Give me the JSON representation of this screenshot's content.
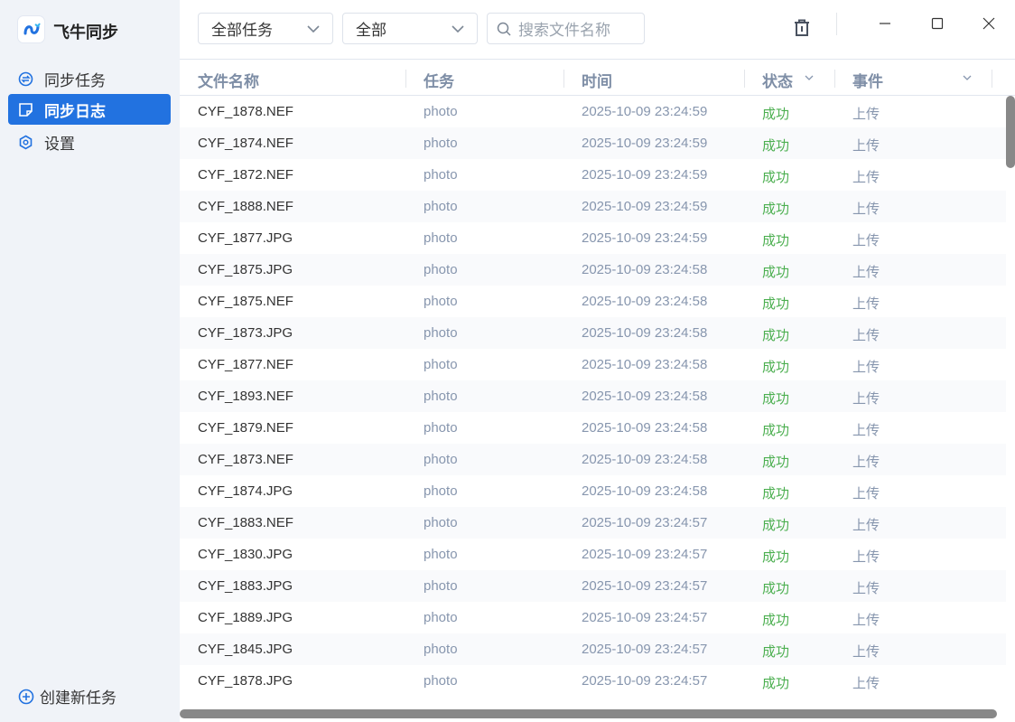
{
  "app": {
    "title": "飞牛同步"
  },
  "sidebar": {
    "items": [
      {
        "label": "同步任务"
      },
      {
        "label": "同步日志"
      },
      {
        "label": "设置"
      }
    ],
    "create_label": "创建新任务"
  },
  "toolbar": {
    "task_filter": "全部任务",
    "status_filter": "全部",
    "search_placeholder": "搜索文件名称"
  },
  "table": {
    "headers": [
      "文件名称",
      "任务",
      "时间",
      "状态",
      "事件"
    ],
    "rows": [
      [
        "CYF_1878.NEF",
        "photo",
        "2025-10-09 23:24:59",
        "成功",
        "上传"
      ],
      [
        "CYF_1874.NEF",
        "photo",
        "2025-10-09 23:24:59",
        "成功",
        "上传"
      ],
      [
        "CYF_1872.NEF",
        "photo",
        "2025-10-09 23:24:59",
        "成功",
        "上传"
      ],
      [
        "CYF_1888.NEF",
        "photo",
        "2025-10-09 23:24:59",
        "成功",
        "上传"
      ],
      [
        "CYF_1877.JPG",
        "photo",
        "2025-10-09 23:24:59",
        "成功",
        "上传"
      ],
      [
        "CYF_1875.JPG",
        "photo",
        "2025-10-09 23:24:58",
        "成功",
        "上传"
      ],
      [
        "CYF_1875.NEF",
        "photo",
        "2025-10-09 23:24:58",
        "成功",
        "上传"
      ],
      [
        "CYF_1873.JPG",
        "photo",
        "2025-10-09 23:24:58",
        "成功",
        "上传"
      ],
      [
        "CYF_1877.NEF",
        "photo",
        "2025-10-09 23:24:58",
        "成功",
        "上传"
      ],
      [
        "CYF_1893.NEF",
        "photo",
        "2025-10-09 23:24:58",
        "成功",
        "上传"
      ],
      [
        "CYF_1879.NEF",
        "photo",
        "2025-10-09 23:24:58",
        "成功",
        "上传"
      ],
      [
        "CYF_1873.NEF",
        "photo",
        "2025-10-09 23:24:58",
        "成功",
        "上传"
      ],
      [
        "CYF_1874.JPG",
        "photo",
        "2025-10-09 23:24:58",
        "成功",
        "上传"
      ],
      [
        "CYF_1883.NEF",
        "photo",
        "2025-10-09 23:24:57",
        "成功",
        "上传"
      ],
      [
        "CYF_1830.JPG",
        "photo",
        "2025-10-09 23:24:57",
        "成功",
        "上传"
      ],
      [
        "CYF_1883.JPG",
        "photo",
        "2025-10-09 23:24:57",
        "成功",
        "上传"
      ],
      [
        "CYF_1889.JPG",
        "photo",
        "2025-10-09 23:24:57",
        "成功",
        "上传"
      ],
      [
        "CYF_1845.JPG",
        "photo",
        "2025-10-09 23:24:57",
        "成功",
        "上传"
      ],
      [
        "CYF_1878.JPG",
        "photo",
        "2025-10-09 23:24:57",
        "成功",
        "上传"
      ]
    ]
  },
  "colors": {
    "accent": "#2272e0",
    "success": "#4caf50"
  }
}
